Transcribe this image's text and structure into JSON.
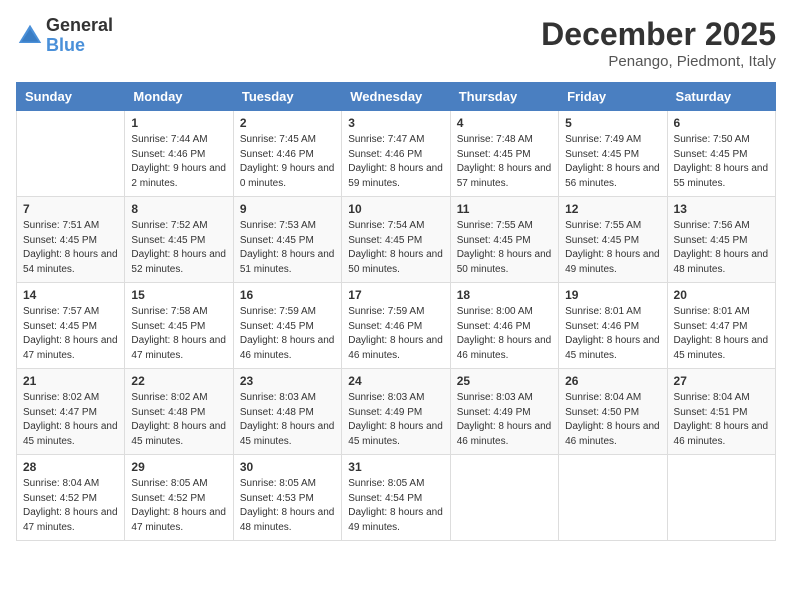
{
  "logo": {
    "general": "General",
    "blue": "Blue"
  },
  "title": "December 2025",
  "location": "Penango, Piedmont, Italy",
  "days_of_week": [
    "Sunday",
    "Monday",
    "Tuesday",
    "Wednesday",
    "Thursday",
    "Friday",
    "Saturday"
  ],
  "weeks": [
    [
      {
        "day": "",
        "sunrise": "",
        "sunset": "",
        "daylight": ""
      },
      {
        "day": "1",
        "sunrise": "Sunrise: 7:44 AM",
        "sunset": "Sunset: 4:46 PM",
        "daylight": "Daylight: 9 hours and 2 minutes."
      },
      {
        "day": "2",
        "sunrise": "Sunrise: 7:45 AM",
        "sunset": "Sunset: 4:46 PM",
        "daylight": "Daylight: 9 hours and 0 minutes."
      },
      {
        "day": "3",
        "sunrise": "Sunrise: 7:47 AM",
        "sunset": "Sunset: 4:46 PM",
        "daylight": "Daylight: 8 hours and 59 minutes."
      },
      {
        "day": "4",
        "sunrise": "Sunrise: 7:48 AM",
        "sunset": "Sunset: 4:45 PM",
        "daylight": "Daylight: 8 hours and 57 minutes."
      },
      {
        "day": "5",
        "sunrise": "Sunrise: 7:49 AM",
        "sunset": "Sunset: 4:45 PM",
        "daylight": "Daylight: 8 hours and 56 minutes."
      },
      {
        "day": "6",
        "sunrise": "Sunrise: 7:50 AM",
        "sunset": "Sunset: 4:45 PM",
        "daylight": "Daylight: 8 hours and 55 minutes."
      }
    ],
    [
      {
        "day": "7",
        "sunrise": "Sunrise: 7:51 AM",
        "sunset": "Sunset: 4:45 PM",
        "daylight": "Daylight: 8 hours and 54 minutes."
      },
      {
        "day": "8",
        "sunrise": "Sunrise: 7:52 AM",
        "sunset": "Sunset: 4:45 PM",
        "daylight": "Daylight: 8 hours and 52 minutes."
      },
      {
        "day": "9",
        "sunrise": "Sunrise: 7:53 AM",
        "sunset": "Sunset: 4:45 PM",
        "daylight": "Daylight: 8 hours and 51 minutes."
      },
      {
        "day": "10",
        "sunrise": "Sunrise: 7:54 AM",
        "sunset": "Sunset: 4:45 PM",
        "daylight": "Daylight: 8 hours and 50 minutes."
      },
      {
        "day": "11",
        "sunrise": "Sunrise: 7:55 AM",
        "sunset": "Sunset: 4:45 PM",
        "daylight": "Daylight: 8 hours and 50 minutes."
      },
      {
        "day": "12",
        "sunrise": "Sunrise: 7:55 AM",
        "sunset": "Sunset: 4:45 PM",
        "daylight": "Daylight: 8 hours and 49 minutes."
      },
      {
        "day": "13",
        "sunrise": "Sunrise: 7:56 AM",
        "sunset": "Sunset: 4:45 PM",
        "daylight": "Daylight: 8 hours and 48 minutes."
      }
    ],
    [
      {
        "day": "14",
        "sunrise": "Sunrise: 7:57 AM",
        "sunset": "Sunset: 4:45 PM",
        "daylight": "Daylight: 8 hours and 47 minutes."
      },
      {
        "day": "15",
        "sunrise": "Sunrise: 7:58 AM",
        "sunset": "Sunset: 4:45 PM",
        "daylight": "Daylight: 8 hours and 47 minutes."
      },
      {
        "day": "16",
        "sunrise": "Sunrise: 7:59 AM",
        "sunset": "Sunset: 4:45 PM",
        "daylight": "Daylight: 8 hours and 46 minutes."
      },
      {
        "day": "17",
        "sunrise": "Sunrise: 7:59 AM",
        "sunset": "Sunset: 4:46 PM",
        "daylight": "Daylight: 8 hours and 46 minutes."
      },
      {
        "day": "18",
        "sunrise": "Sunrise: 8:00 AM",
        "sunset": "Sunset: 4:46 PM",
        "daylight": "Daylight: 8 hours and 46 minutes."
      },
      {
        "day": "19",
        "sunrise": "Sunrise: 8:01 AM",
        "sunset": "Sunset: 4:46 PM",
        "daylight": "Daylight: 8 hours and 45 minutes."
      },
      {
        "day": "20",
        "sunrise": "Sunrise: 8:01 AM",
        "sunset": "Sunset: 4:47 PM",
        "daylight": "Daylight: 8 hours and 45 minutes."
      }
    ],
    [
      {
        "day": "21",
        "sunrise": "Sunrise: 8:02 AM",
        "sunset": "Sunset: 4:47 PM",
        "daylight": "Daylight: 8 hours and 45 minutes."
      },
      {
        "day": "22",
        "sunrise": "Sunrise: 8:02 AM",
        "sunset": "Sunset: 4:48 PM",
        "daylight": "Daylight: 8 hours and 45 minutes."
      },
      {
        "day": "23",
        "sunrise": "Sunrise: 8:03 AM",
        "sunset": "Sunset: 4:48 PM",
        "daylight": "Daylight: 8 hours and 45 minutes."
      },
      {
        "day": "24",
        "sunrise": "Sunrise: 8:03 AM",
        "sunset": "Sunset: 4:49 PM",
        "daylight": "Daylight: 8 hours and 45 minutes."
      },
      {
        "day": "25",
        "sunrise": "Sunrise: 8:03 AM",
        "sunset": "Sunset: 4:49 PM",
        "daylight": "Daylight: 8 hours and 46 minutes."
      },
      {
        "day": "26",
        "sunrise": "Sunrise: 8:04 AM",
        "sunset": "Sunset: 4:50 PM",
        "daylight": "Daylight: 8 hours and 46 minutes."
      },
      {
        "day": "27",
        "sunrise": "Sunrise: 8:04 AM",
        "sunset": "Sunset: 4:51 PM",
        "daylight": "Daylight: 8 hours and 46 minutes."
      }
    ],
    [
      {
        "day": "28",
        "sunrise": "Sunrise: 8:04 AM",
        "sunset": "Sunset: 4:52 PM",
        "daylight": "Daylight: 8 hours and 47 minutes."
      },
      {
        "day": "29",
        "sunrise": "Sunrise: 8:05 AM",
        "sunset": "Sunset: 4:52 PM",
        "daylight": "Daylight: 8 hours and 47 minutes."
      },
      {
        "day": "30",
        "sunrise": "Sunrise: 8:05 AM",
        "sunset": "Sunset: 4:53 PM",
        "daylight": "Daylight: 8 hours and 48 minutes."
      },
      {
        "day": "31",
        "sunrise": "Sunrise: 8:05 AM",
        "sunset": "Sunset: 4:54 PM",
        "daylight": "Daylight: 8 hours and 49 minutes."
      },
      {
        "day": "",
        "sunrise": "",
        "sunset": "",
        "daylight": ""
      },
      {
        "day": "",
        "sunrise": "",
        "sunset": "",
        "daylight": ""
      },
      {
        "day": "",
        "sunrise": "",
        "sunset": "",
        "daylight": ""
      }
    ]
  ]
}
